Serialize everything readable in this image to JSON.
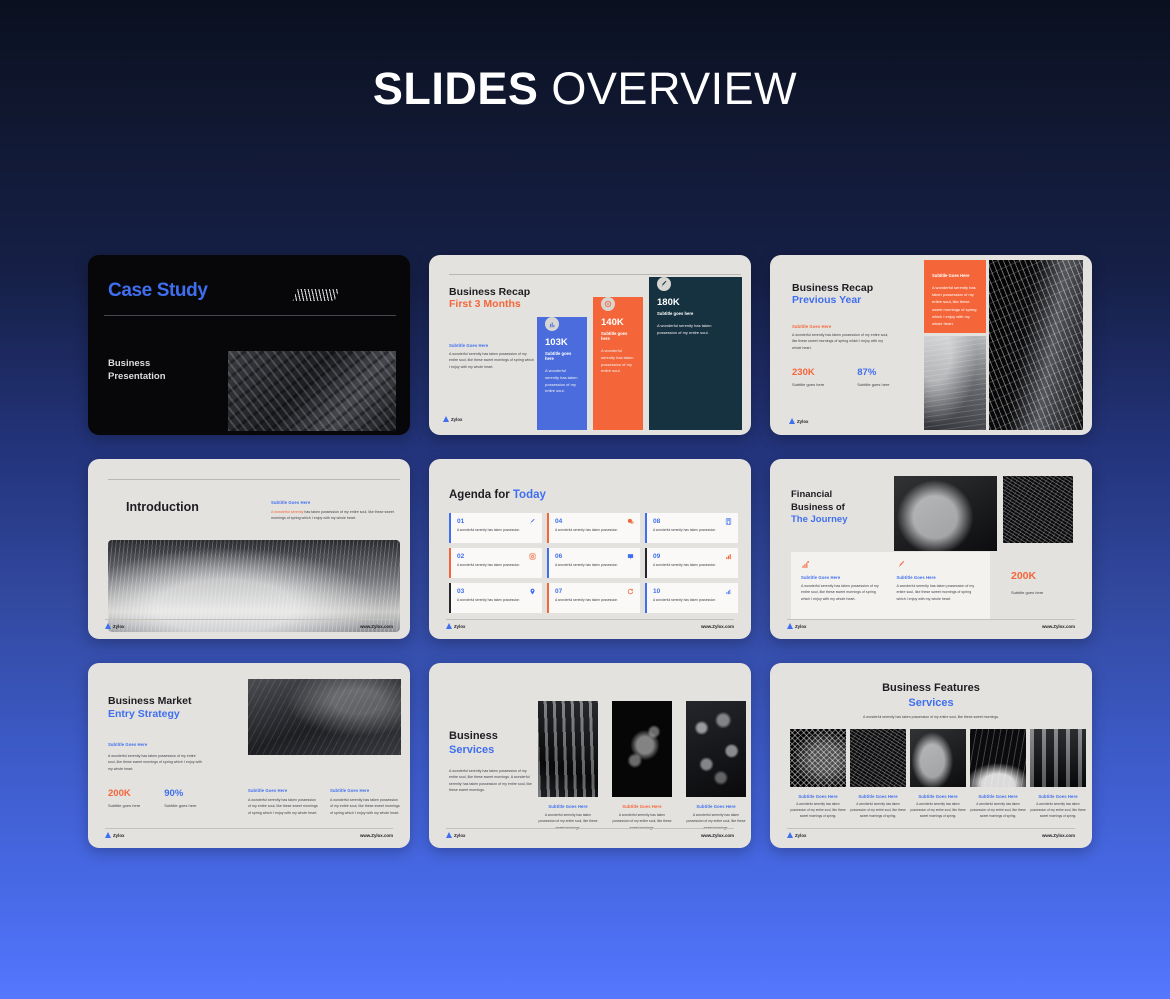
{
  "header": {
    "title_bold": "SLIDES",
    "title_light": " OVERVIEW"
  },
  "brand": {
    "name": "Zylox",
    "url": "www.Zylox.com",
    "logo_icon": "triangle-logo-icon"
  },
  "colors": {
    "accent_blue": "#3f6ff0",
    "accent_orange": "#f4663a",
    "dark": "#1d1d22",
    "slide_bg": "#e4e2de",
    "navy": "#16313f"
  },
  "slides": [
    {
      "id": "case-study",
      "title": "Case Study",
      "subtitle_line1": "Business",
      "subtitle_line2": "Presentation"
    },
    {
      "id": "business-recap-first-3-months",
      "title_line1": "Business Recap",
      "title_line2": "First 3 Months",
      "intro_heading": "Subtitle Goes Here",
      "intro_body": "A wonderful serenity has taken possession of my entire soul, like these sweet mornings of spring which I enjoy with my whole heart.",
      "bars": [
        {
          "value": "103K",
          "caption": "Subtitle goes here",
          "body": "A wonderful serenity has taken possession of my entire soul.",
          "icon": "bar-chart-icon",
          "color": "#4a6cdd"
        },
        {
          "value": "140K",
          "caption": "Subtitle goes here",
          "body": "A wonderful serenity has taken possession of my entire soul.",
          "icon": "target-icon",
          "color": "#f4663a"
        },
        {
          "value": "180K",
          "caption": "Subtitle goes here",
          "body": "A wonderful serenity has taken possession of my entire soul.",
          "icon": "rocket-icon",
          "color": "#16313f"
        }
      ]
    },
    {
      "id": "business-recap-previous-year",
      "title_line1": "Business Recap",
      "title_line2": "Previous Year",
      "intro_heading": "Subtitle Goes Here",
      "intro_body": "A wonderful serenity has taken possession of my entire soul, like these sweet mornings of spring which I enjoy with my whole heart.",
      "stats": [
        {
          "value": "230K",
          "caption": "Subtitle goes here",
          "color": "#f4663a"
        },
        {
          "value": "87%",
          "caption": "Subtitle goes here",
          "color": "#3f6ff0"
        }
      ],
      "orange_panel": {
        "heading": "Subtitle Goes Here",
        "body": "A wonderful serenity has taken possession of my entire soul, like these sweet mornings of spring which I enjoy with my whole heart."
      },
      "images": [
        "dune-photo",
        "building-facade-photo"
      ]
    },
    {
      "id": "introduction",
      "title": "Introduction",
      "side_heading": "Subtitle Goes Here",
      "side_body_highlight": "A wonderful serenity",
      "side_body": " has taken possession of my entire soul, like these sweet mornings of spring which I enjoy with my whole heart.",
      "image": "notebook-pen-photo"
    },
    {
      "id": "agenda-for-today",
      "title_dark": "Agenda for ",
      "title_blue": "Today",
      "items": [
        {
          "num": "01",
          "text": "A wonderful serenity has taken possession",
          "icon": "rocket-icon",
          "accent": "blue"
        },
        {
          "num": "04",
          "text": "A wonderful serenity has taken possession",
          "icon": "pie-chart-icon",
          "accent": "orange"
        },
        {
          "num": "08",
          "text": "A wonderful serenity has taken possession",
          "icon": "calculator-icon",
          "accent": "blue"
        },
        {
          "num": "02",
          "text": "A wonderful serenity has taken possession",
          "icon": "target-icon",
          "accent": "orange"
        },
        {
          "num": "06",
          "text": "A wonderful serenity has taken possession",
          "icon": "presentation-icon",
          "accent": "blue"
        },
        {
          "num": "09",
          "text": "A wonderful serenity has taken possession",
          "icon": "bar-chart-icon",
          "accent": "dark"
        },
        {
          "num": "03",
          "text": "A wonderful serenity has taken possession",
          "icon": "location-pin-icon",
          "accent": "dark"
        },
        {
          "num": "07",
          "text": "A wonderful serenity has taken possession",
          "icon": "refresh-icon",
          "accent": "orange"
        },
        {
          "num": "10",
          "text": "A wonderful serenity has taken possession",
          "icon": "growth-chart-icon",
          "accent": "blue"
        }
      ]
    },
    {
      "id": "financial-business",
      "title_line1": "Financial",
      "title_line2": "Business of",
      "title_line3": "The Journey",
      "features": [
        {
          "icon": "growth-chart-icon",
          "heading": "Subtitle Goes Here",
          "body": "A wonderful serenity has taken possession of my entire soul, like these sweet mornings of spring which I enjoy with my whole heart."
        },
        {
          "icon": "rocket-icon",
          "heading": "Subtitle Goes Here",
          "body": "A wonderful serenity has taken possession of my entire soul, like these sweet mornings of spring which I enjoy with my whole heart."
        }
      ],
      "stat": {
        "value": "200K",
        "caption": "Subtitle goes here"
      },
      "images": [
        "architecture-photo",
        "weave-pattern-photo"
      ]
    },
    {
      "id": "business-market-entry-strategy",
      "title_line1": "Business Market",
      "title_line2": "Entry Strategy",
      "intro_heading": "Subtitle Goes Here",
      "intro_body": "A wonderful serenity has taken possession of my entire soul, like these sweet mornings of spring which I enjoy with my whole heart.",
      "stats": [
        {
          "value": "200K",
          "caption": "Subtitle goes here",
          "color": "#f4663a"
        },
        {
          "value": "90%",
          "caption": "Subtitle goes here",
          "color": "#3f6ff0"
        }
      ],
      "columns": [
        {
          "heading": "Subtitle Goes Here",
          "body": "A wonderful serenity has taken possession of my entire soul, like these sweet mornings of spring which I enjoy with my whole heart."
        },
        {
          "heading": "Subtitle Goes Here",
          "body": "A wonderful serenity has taken possession of my entire soul, like these sweet mornings of spring which I enjoy with my whole heart."
        }
      ],
      "image": "laptop-desk-photo"
    },
    {
      "id": "business-services",
      "title_line1": "Business",
      "title_line2": "Services",
      "intro_body": "A wonderful serenity has taken possession of my entire soul, like these sweet mornings. A wonderful serenity has taken possession of my entire soul, like these sweet mornings.",
      "cards": [
        {
          "image": "pillars-photo",
          "heading": "Subtitle Goes Here",
          "heading_color": "blue",
          "body": "A wonderful serenity has taken possession of my entire soul, like these sweet mornings."
        },
        {
          "image": "leaf-photo",
          "heading": "Subtitle Goes Here",
          "heading_color": "orange",
          "body": "A wonderful serenity has taken possession of my entire soul, like these sweet mornings."
        },
        {
          "image": "bokeh-photo",
          "heading": "Subtitle Goes Here",
          "heading_color": "blue",
          "body": "A wonderful serenity has taken possession of my entire soul, like these sweet mornings."
        }
      ]
    },
    {
      "id": "business-features-services",
      "title_dark": "Business Features",
      "title_blue": "Services",
      "lead": "A wonderful serenity has taken possession of my entire soul, like these sweet mornings.",
      "cards": [
        {
          "image": "mesh-dome-photo",
          "heading": "Subtitle Goes Here",
          "body": "A wonderful serenity has taken possession of my entire soul, like these sweet mornings of spring."
        },
        {
          "image": "weave-pattern-photo",
          "heading": "Subtitle Goes Here",
          "body": "A wonderful serenity has taken possession of my entire soul, like these sweet mornings of spring."
        },
        {
          "image": "arch-photo",
          "heading": "Subtitle Goes Here",
          "body": "A wonderful serenity has taken possession of my entire soul, like these sweet mornings of spring."
        },
        {
          "image": "swoosh-photo",
          "heading": "Subtitle Goes Here",
          "body": "A wonderful serenity has taken possession of my entire soul, like these sweet mornings of spring."
        },
        {
          "image": "hall-photo",
          "heading": "Subtitle Goes Here",
          "body": "A wonderful serenity has taken possession of my entire soul, like these sweet mornings of spring."
        }
      ]
    }
  ]
}
